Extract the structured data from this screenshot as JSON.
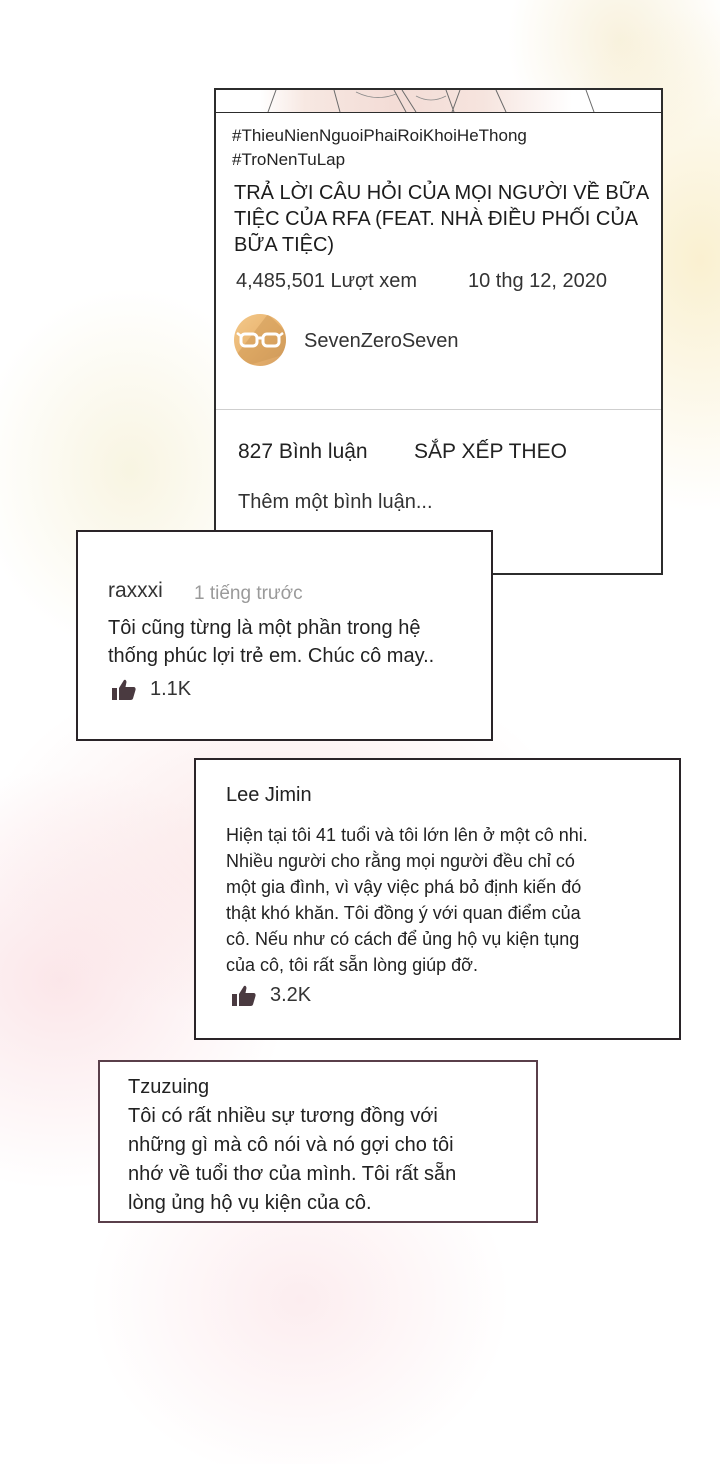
{
  "video": {
    "hashtags": [
      "#ThieuNienNguoiPhaiRoiKhoiHeThong",
      "#TroNenTuLap"
    ],
    "title": "TRẢ LỜI CÂU HỎI CỦA MỌI NGƯỜI VỀ BỮA TIỆC CỦA RFA (FEAT. NHÀ ĐIỀU PHỐI CỦA BỮA TIỆC)",
    "views": "4,485,501 Lượt xem",
    "date": "10 thg 12, 2020",
    "channel": "SevenZeroSeven",
    "comment_count": "827 Bình luận",
    "sort_label": "SẮP XẾP THEO",
    "add_comment_placeholder": "Thêm một bình luận..."
  },
  "comments": [
    {
      "user": "raxxxi",
      "time": "1 tiếng trước",
      "text": "Tôi cũng từng là một phần trong hệ\nthống phúc lợi trẻ em. Chúc cô may..",
      "likes": "1.1K"
    },
    {
      "user": "Lee Jimin",
      "text": "Hiện tại tôi 41 tuổi và tôi lớn lên ở một cô nhi.\nNhiều người cho rằng mọi người đều chỉ có\nmột gia đình, vì vậy việc phá bỏ định kiến đó\nthật khó khăn. Tôi đồng ý với quan điểm của\ncô. Nếu như có cách để ủng hộ vụ kiện tụng\ncủa cô, tôi rất sẵn lòng giúp đỡ.",
      "likes": "3.2K"
    },
    {
      "user": "Tzuzuing",
      "text": "Tôi có rất nhiều sự tương đồng với\nnhững gì mà cô nói và nó gợi cho tôi\nnhớ về tuổi thơ của mình. Tôi rất sẵn\nlòng ủng hộ vụ kiện của cô."
    }
  ],
  "icons": {
    "like": "thumbs-up-icon",
    "avatar": "glasses-icon"
  },
  "colors": {
    "like_icon": "#4a3a40",
    "avatar_bg": "#ecb877",
    "border": "#2a2428"
  }
}
